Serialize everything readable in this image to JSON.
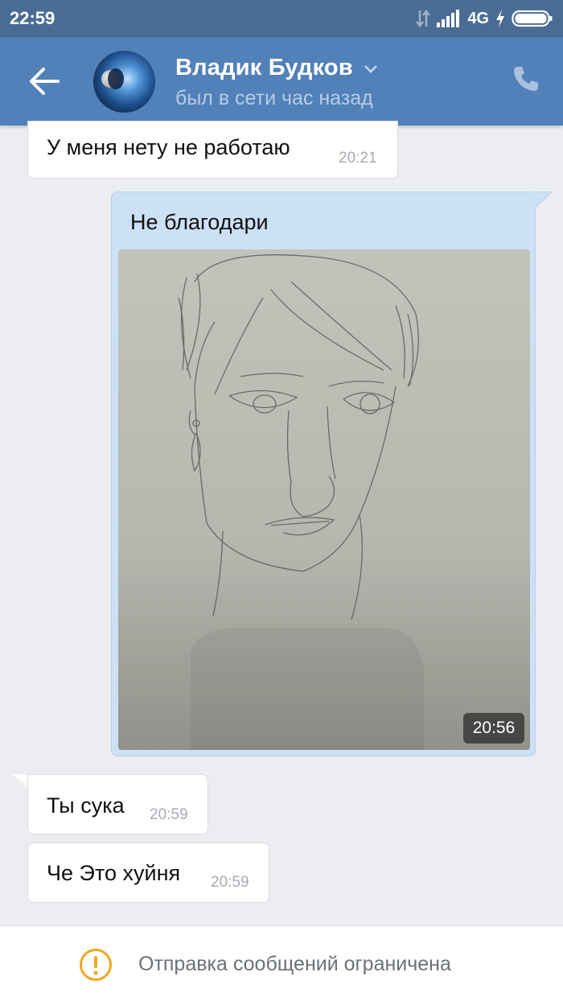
{
  "status_bar": {
    "time": "22:59",
    "network": "4G",
    "icons": [
      "data-arrows-icon",
      "signal-bars-icon",
      "charging-bolt-icon",
      "battery-icon"
    ]
  },
  "header": {
    "name": "Владик Будков",
    "status": "был в сети час назад",
    "icons": [
      "back-arrow-icon",
      "avatar",
      "chevron-down-icon",
      "phone-icon"
    ]
  },
  "messages": [
    {
      "direction": "in",
      "text": "У меня нету не работаю",
      "time": "20:21"
    },
    {
      "direction": "out",
      "text": "Не благодари",
      "has_photo": true,
      "time": "20:56"
    },
    {
      "direction": "in",
      "text": "Ты сука",
      "time": "20:59"
    },
    {
      "direction": "in",
      "text": "Че Это хуйня",
      "time": "20:59"
    }
  ],
  "footer": {
    "notice": "Отправка сообщений ограничена",
    "icon": "warning-icon"
  },
  "colors": {
    "header": "#5181b8",
    "statusbar": "#4a6c94",
    "background": "#ebedf0",
    "out_bubble": "#cce0f6",
    "warning": "#f0a81c"
  }
}
